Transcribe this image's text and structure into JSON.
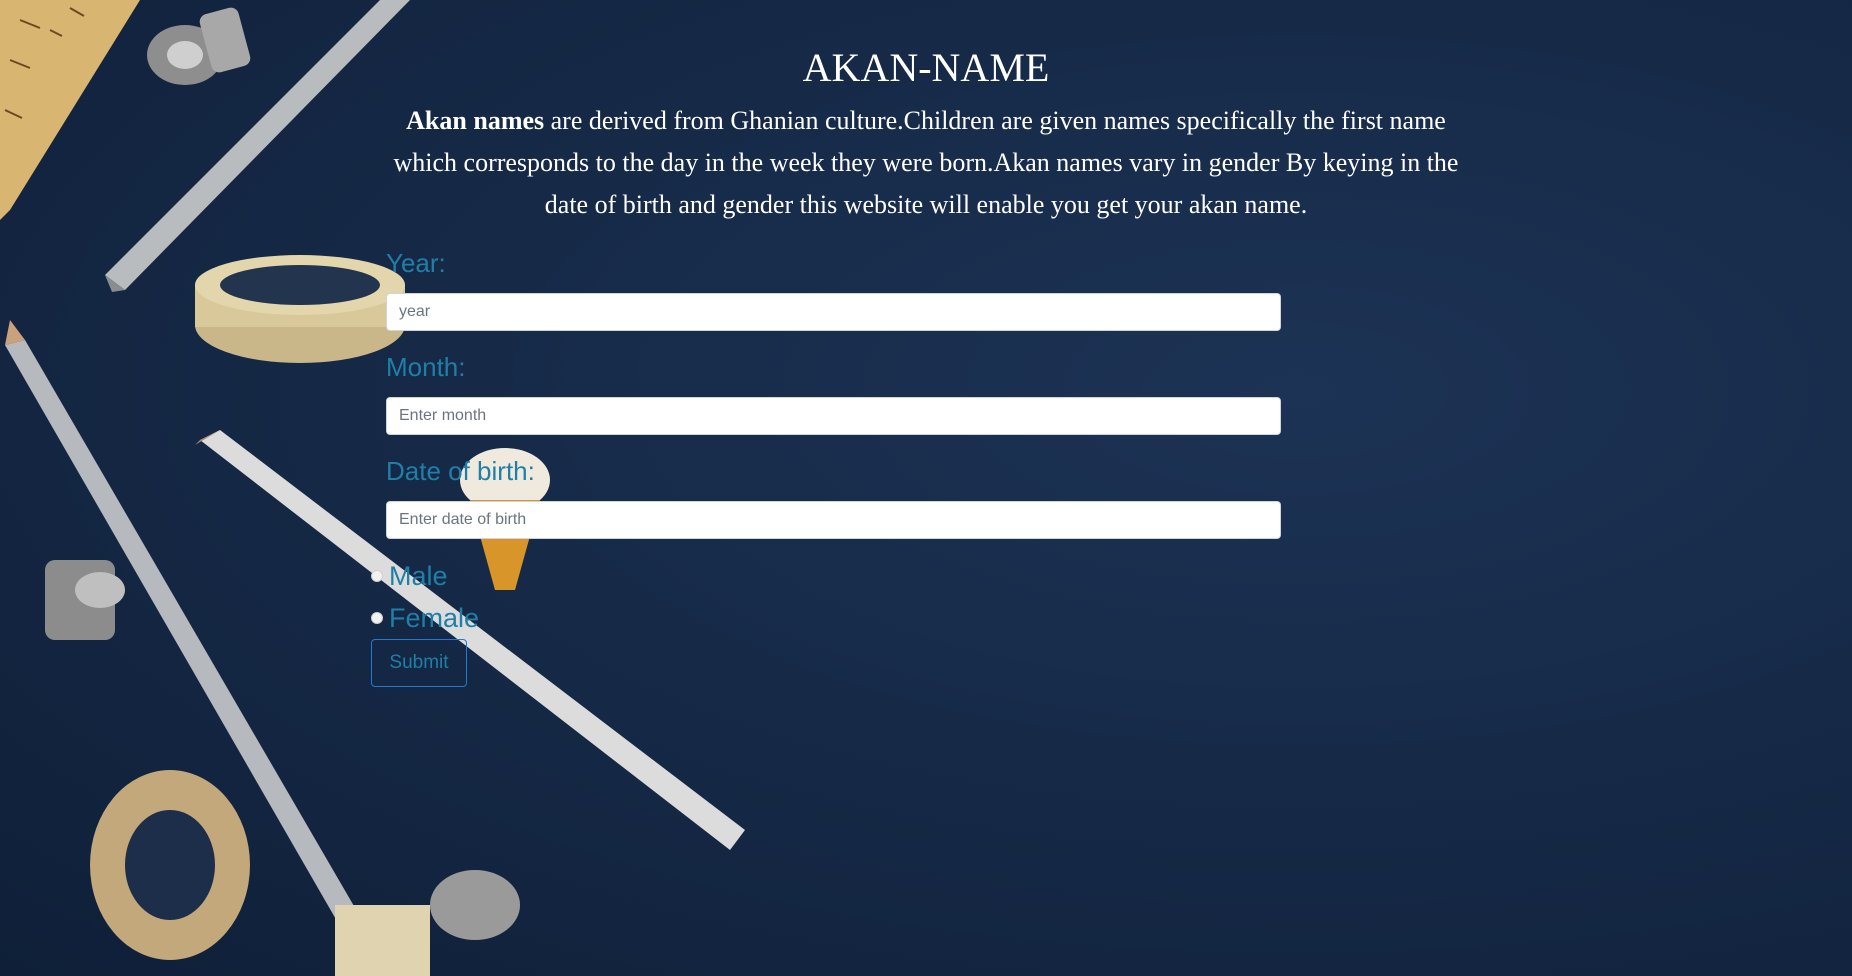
{
  "page": {
    "title": "AKAN-NAME",
    "intro_bold": "Akan names",
    "intro_rest": " are derived from Ghanian culture.Children are given names specifically the first name which corresponds to the day in the week they were born.Akan names vary in gender By keying in the date of birth and gender this website will enable you get your akan name."
  },
  "form": {
    "year": {
      "label": "Year:",
      "placeholder": "year",
      "value": ""
    },
    "month": {
      "label": "Month:",
      "placeholder": "Enter month",
      "value": ""
    },
    "dob": {
      "label": "Date of birth:",
      "placeholder": "Enter date of birth",
      "value": ""
    },
    "gender": {
      "male_label": "Male",
      "female_label": "Female",
      "selected": null
    },
    "submit_label": "Submit"
  },
  "colors": {
    "background": "#162a48",
    "label_accent": "#1f7fa6",
    "button_border": "#1f7ad6",
    "heading_text": "#ffffff"
  }
}
